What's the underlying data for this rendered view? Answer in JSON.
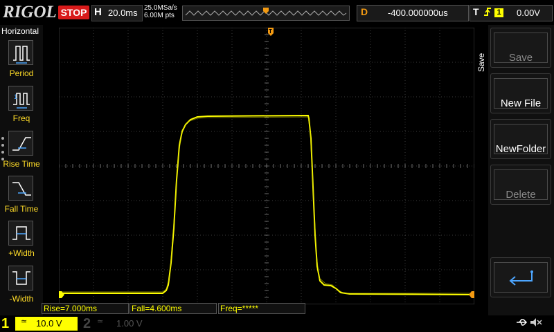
{
  "header": {
    "logo": "RIGOL",
    "run_state": "STOP",
    "h_label": "H",
    "timebase": "20.0ms",
    "sample_rate": "25.0MSa/s",
    "memory_depth": "6.00M pts",
    "delay_label": "D",
    "delay_value": "-400.000000us",
    "trigger_label": "T",
    "trigger_source": "1",
    "trigger_level": "0.00V",
    "trigger_marker": "T"
  },
  "left_menu": {
    "title": "Horizontal",
    "items": [
      {
        "label": "Period",
        "icon": "period-icon"
      },
      {
        "label": "Freq",
        "icon": "freq-icon"
      },
      {
        "label": "Rise Time",
        "icon": "rise-time-icon"
      },
      {
        "label": "Fall Time",
        "icon": "fall-time-icon"
      },
      {
        "label": "+Width",
        "icon": "positive-width-icon"
      },
      {
        "label": "-Width",
        "icon": "negative-width-icon"
      }
    ]
  },
  "right_menu": {
    "title": "Save",
    "buttons": [
      {
        "label": "Save",
        "enabled": false
      },
      {
        "label": "New File",
        "enabled": true
      },
      {
        "label": "NewFolder",
        "enabled": true
      },
      {
        "label": "Delete",
        "enabled": false
      },
      {
        "label": "",
        "icon": "return-icon",
        "enabled": true
      }
    ]
  },
  "measurements": {
    "rise": "Rise=7.000ms",
    "fall": "Fall=4.600ms",
    "freq": "Freq=*****"
  },
  "channels": {
    "ch1_number": "1",
    "ch1_scale": "10.0 V",
    "ch1_coupling": "≃",
    "ch2_number": "2",
    "ch2_scale": "1.00 V",
    "ch2_coupling": "≃"
  },
  "colors": {
    "ch1": "#ffff00",
    "trigger": "#f39a12",
    "stop": "#d81a1a",
    "grid": "#3c3c3c"
  }
}
